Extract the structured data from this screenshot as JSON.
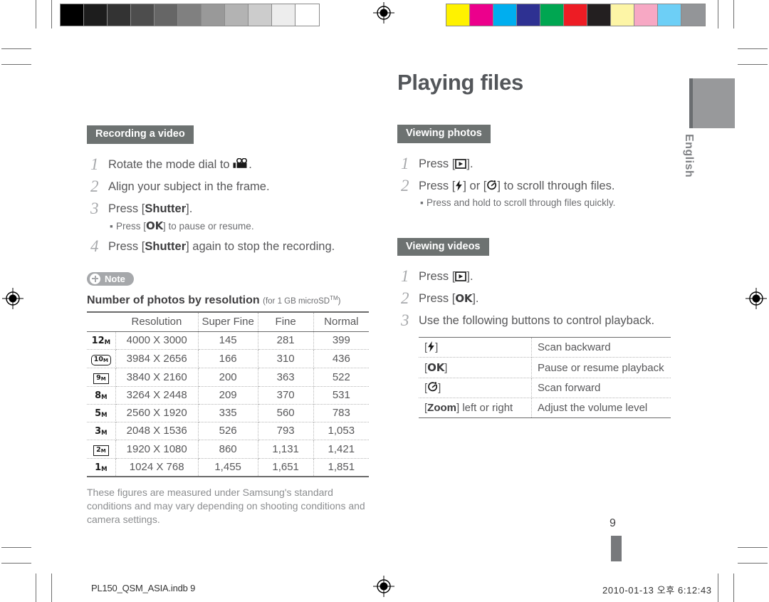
{
  "print_marks": {
    "gray_scale_swatches": [
      "#000000",
      "#1d1d1d",
      "#333333",
      "#4d4d4d",
      "#666666",
      "#808080",
      "#999999",
      "#b3b3b3",
      "#cccccc",
      "#ededed",
      "#ffffff"
    ],
    "color_bar_swatches": [
      "#fff200",
      "#ec008c",
      "#00aeef",
      "#2e3192",
      "#00a651",
      "#ed1c24",
      "#231f20",
      "#fdf5a6",
      "#f7a8c4",
      "#6dcff6",
      "#939598"
    ],
    "registration_icon": "registration-target-icon"
  },
  "left_column": {
    "section": {
      "tag": "Recording a video",
      "steps": [
        {
          "num": "1",
          "text_before": "Rotate the mode dial to ",
          "icon": "camcorder-icon",
          "text_after": "."
        },
        {
          "num": "2",
          "text_before": "Align your subject in the frame.",
          "icon": "",
          "text_after": ""
        },
        {
          "num": "3",
          "text_before": "Press [",
          "bold": "Shutter",
          "text_after": "].",
          "subnote_before": "Press [",
          "subnote_key": "OK",
          "subnote_after": "] to pause or resume."
        },
        {
          "num": "4",
          "text_before": "Press [",
          "bold": "Shutter",
          "text_after": "] again to stop the recording."
        }
      ]
    },
    "note_badge": "Note",
    "table": {
      "caption": "Number of photos by resolution",
      "caption_sub": "(for 1 GB microSD",
      "caption_sub_sup": "TM",
      "caption_sub_close": ")",
      "headers": [
        "Resolution",
        "Super Fine",
        "Fine",
        "Normal"
      ],
      "rows": [
        {
          "badge": "12",
          "badge_sub": "M",
          "badge_style": "plain",
          "resolution": "4000 X 3000",
          "super_fine": "145",
          "fine": "281",
          "normal": "399"
        },
        {
          "badge": "10",
          "badge_sub": "M",
          "badge_style": "rounded",
          "resolution": "3984 X 2656",
          "super_fine": "166",
          "fine": "310",
          "normal": "436"
        },
        {
          "badge": "9",
          "badge_sub": "M",
          "badge_style": "boxed",
          "resolution": "3840 X 2160",
          "super_fine": "200",
          "fine": "363",
          "normal": "522"
        },
        {
          "badge": "8",
          "badge_sub": "M",
          "badge_style": "plain",
          "resolution": "3264 X 2448",
          "super_fine": "209",
          "fine": "370",
          "normal": "531"
        },
        {
          "badge": "5",
          "badge_sub": "M",
          "badge_style": "plain",
          "resolution": "2560 X 1920",
          "super_fine": "335",
          "fine": "560",
          "normal": "783"
        },
        {
          "badge": "3",
          "badge_sub": "M",
          "badge_style": "plain",
          "resolution": "2048 X 1536",
          "super_fine": "526",
          "fine": "793",
          "normal": "1,053"
        },
        {
          "badge": "2",
          "badge_sub": "M",
          "badge_style": "boxed",
          "resolution": "1920 X 1080",
          "super_fine": "860",
          "fine": "1,131",
          "normal": "1,421"
        },
        {
          "badge": "1",
          "badge_sub": "M",
          "badge_style": "plain",
          "resolution": "1024 X 768",
          "super_fine": "1,455",
          "fine": "1,651",
          "normal": "1,851"
        }
      ],
      "footnote": "These figures are measured under Samsung's standard conditions and may vary depending on shooting conditions and camera settings."
    }
  },
  "right_column": {
    "title": "Playing files",
    "photos_section": {
      "tag": "Viewing photos",
      "steps": [
        {
          "num": "1",
          "text_before": "Press [",
          "icon": "playback-icon",
          "text_after": "]."
        },
        {
          "num": "2",
          "text_before": "Press [",
          "icon": "flash-icon",
          "text_mid": "] or [",
          "icon2": "timer-icon",
          "text_after": "] to scroll through files.",
          "subnote": "Press and hold to scroll through files quickly."
        }
      ]
    },
    "videos_section": {
      "tag": "Viewing videos",
      "steps": [
        {
          "num": "1",
          "text_before": "Press [",
          "icon": "playback-icon",
          "text_after": "]."
        },
        {
          "num": "2",
          "text_before": "Press [",
          "bold": "OK",
          "text_after": "]."
        },
        {
          "num": "3",
          "text_before": "Use the following buttons to control playback."
        }
      ],
      "control_table": [
        {
          "key_icon": "flash-icon",
          "key_bold": "",
          "key_suffix": "",
          "description": "Scan backward"
        },
        {
          "key_icon": "",
          "key_bold": "OK",
          "key_suffix": "",
          "description": "Pause or resume playback"
        },
        {
          "key_icon": "timer-icon",
          "key_bold": "",
          "key_suffix": "",
          "description": "Scan forward"
        },
        {
          "key_icon": "",
          "key_bold": "Zoom",
          "key_suffix": " left or right",
          "description": "Adjust the volume level"
        }
      ]
    }
  },
  "language_tab": "English",
  "page_number": "9",
  "footer": {
    "file_name": "PL150_QSM_ASIA.indb   9",
    "timestamp": "2010-01-13   오후 6:12:43"
  }
}
